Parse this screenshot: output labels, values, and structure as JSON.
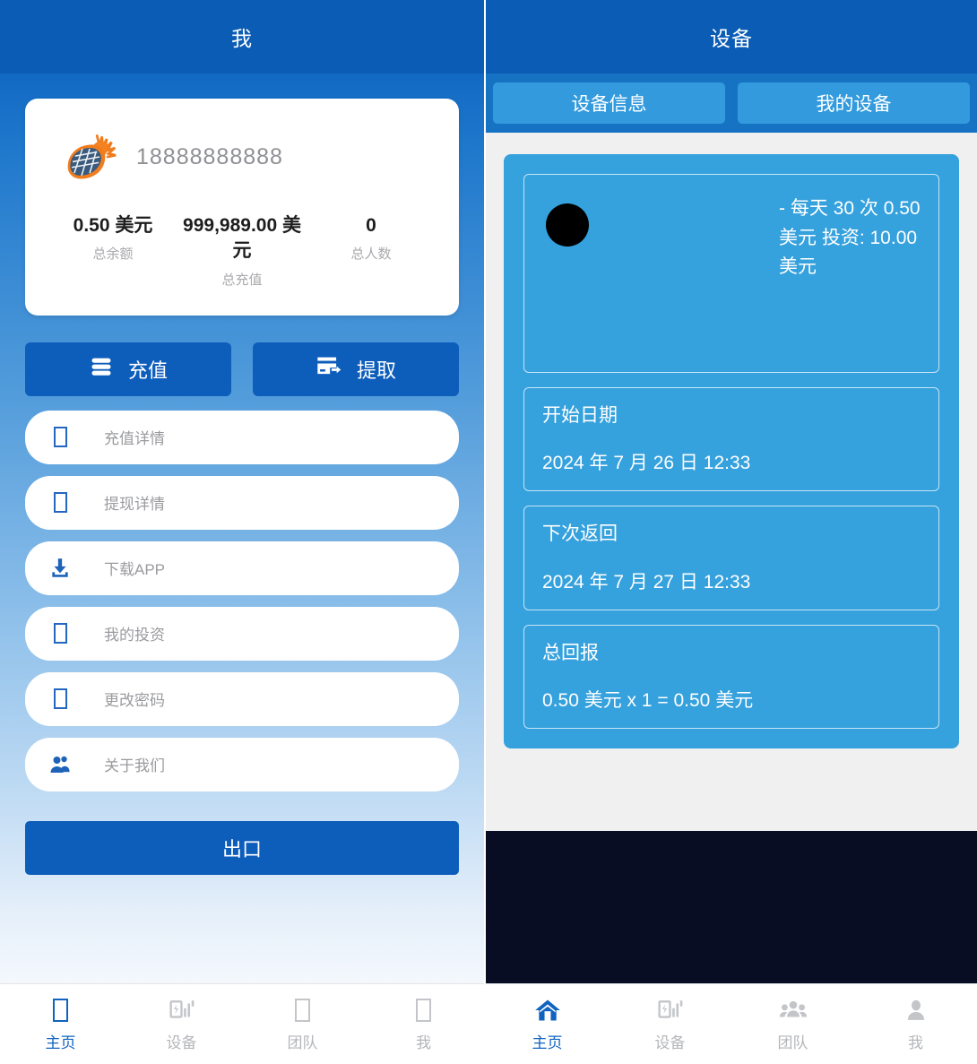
{
  "left": {
    "header": {
      "title": "我"
    },
    "profile": {
      "logo_icon": "solar-globe-logo",
      "phone": "18888888888",
      "stats": [
        {
          "value": "0.50 美元",
          "label": "总余额"
        },
        {
          "value": "999,989.00 美元",
          "label": "总充值"
        },
        {
          "value": "0",
          "label": "总人数"
        }
      ]
    },
    "actions": [
      {
        "label": "充值",
        "icon": "money-stack-icon"
      },
      {
        "label": "提取",
        "icon": "card-arrow-icon"
      }
    ],
    "menu": [
      {
        "label": "充值详情",
        "icon": "missing-glyph-icon"
      },
      {
        "label": "提现详情",
        "icon": "missing-glyph-icon"
      },
      {
        "label": "下载APP",
        "icon": "download-icon"
      },
      {
        "label": "我的投资",
        "icon": "missing-glyph-icon"
      },
      {
        "label": "更改密码",
        "icon": "missing-glyph-icon"
      },
      {
        "label": "关于我们",
        "icon": "users-icon"
      }
    ],
    "logout": {
      "label": "出口"
    },
    "bottom_nav": [
      {
        "label": "主页",
        "icon": "missing-glyph-icon",
        "active": true
      },
      {
        "label": "设备",
        "icon": "device-chart-icon",
        "active": false
      },
      {
        "label": "团队",
        "icon": "missing-glyph-icon",
        "active": false
      },
      {
        "label": "我",
        "icon": "missing-glyph-icon",
        "active": false
      }
    ]
  },
  "right": {
    "header": {
      "title": "设备"
    },
    "tabs": [
      {
        "label": "设备信息"
      },
      {
        "label": "我的设备"
      }
    ],
    "device": {
      "thumb_icon": "broken-image-circle",
      "hero_lines": "- 每天 30 次 0.50 美元 投资: 10.00 美元",
      "boxes": [
        {
          "title": "开始日期",
          "value": "2024 年 7 月 26 日 12:33"
        },
        {
          "title": "下次返回",
          "value": "2024 年 7 月 27 日 12:33"
        },
        {
          "title": "总回报",
          "value": "0.50 美元 x 1 = 0.50 美元"
        }
      ]
    },
    "bottom_nav": [
      {
        "label": "主页",
        "icon": "home-icon",
        "active": true
      },
      {
        "label": "设备",
        "icon": "device-chart-icon",
        "active": false
      },
      {
        "label": "团队",
        "icon": "users-group-icon",
        "active": false
      },
      {
        "label": "我",
        "icon": "person-icon",
        "active": false
      }
    ]
  },
  "colors": {
    "header_blue": "#0b5cb5",
    "button_blue": "#0d5dbb",
    "tab_blue": "#339bdd",
    "card_blue": "#35a1dd",
    "dark_block": "#090d23",
    "accent": "#1064c0"
  }
}
